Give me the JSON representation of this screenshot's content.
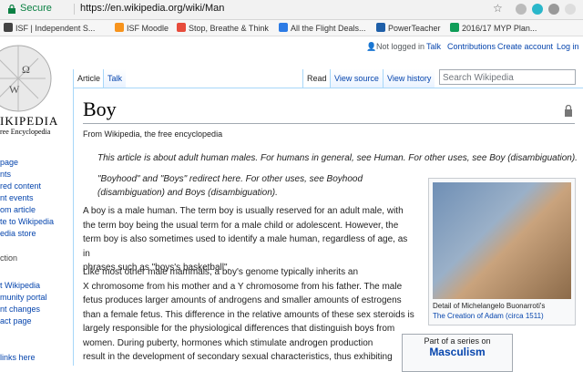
{
  "browser": {
    "secure_label": "Secure",
    "url": "https://en.wikipedia.org/wiki/Man",
    "bookmarks": [
      {
        "label": "ISF | Independent S...",
        "color": "#444"
      },
      {
        "label": "ISF Moodle",
        "color": "#f7941d"
      },
      {
        "label": "Stop, Breathe & Think",
        "color": "#e74c3c"
      },
      {
        "label": "All the Flight Deals...",
        "color": "#2c7be5"
      },
      {
        "label": "PowerTeacher",
        "color": "#1f5fa8"
      },
      {
        "label": "2016/17 MYP Plan...",
        "color": "#0f9d58"
      }
    ]
  },
  "logo": {
    "wordmark": "IKIPEDIA",
    "tagline": "ree Encyclopedia"
  },
  "sidebar": {
    "items": [
      "page",
      "nts",
      "red content",
      "nt events",
      "om article",
      "te to Wikipedia",
      "edia store"
    ],
    "heading2": "ction",
    "items2": [
      "t Wikipedia",
      "munity portal",
      "nt changes",
      "act page"
    ],
    "bottom": "links here"
  },
  "personal": {
    "not_logged_in": "Not logged in",
    "talk": "Talk",
    "contributions": "Contributions",
    "create_account": "Create account",
    "login": "Log in"
  },
  "tabs": {
    "article": "Article",
    "talk": "Talk",
    "read": "Read",
    "view_source": "View source",
    "view_history": "View history"
  },
  "search": {
    "placeholder": "Search Wikipedia"
  },
  "article": {
    "title": "Boy",
    "from": "From Wikipedia, the free encyclopedia",
    "hatnote1": "This article is about adult human males. For humans in general, see Human. For other uses, see Boy (disambiguation).",
    "hatnote2a": "\"Boyhood\" and \"Boys\" redirect here. For other uses, see Boyhood",
    "hatnote2b": "(disambiguation) and Boys (disambiguation).",
    "p1": [
      "A boy is a male human. The term boy is usually reserved for an adult male, with",
      "the term boy being the usual term for a male child or adolescent. However, the",
      "term boy is also sometimes used to identify a male human, regardless of age, as in",
      "phrases such as \"boys's basketball\"."
    ],
    "p2": [
      "Like most other male mammals, a boy's genome typically inherits an",
      "X chromosome from his mother and a Y chromosome from his father. The male",
      "fetus produces larger amounts of androgens and smaller amounts of estrogens",
      "than a female fetus. This difference in the relative amounts of these sex steroids is",
      "largely responsible for the physiological differences that distinguish boys from",
      "women. During puberty, hormones which stimulate androgen production",
      "result in the development of secondary sexual characteristics, thus exhibiting"
    ]
  },
  "infobox": {
    "caption1": "Detail of Michelangelo Buonarroti's",
    "caption2": "The Creation of Adam (circa 1511)"
  },
  "series": {
    "part_of": "Part of a series on",
    "title": "Masculism"
  }
}
